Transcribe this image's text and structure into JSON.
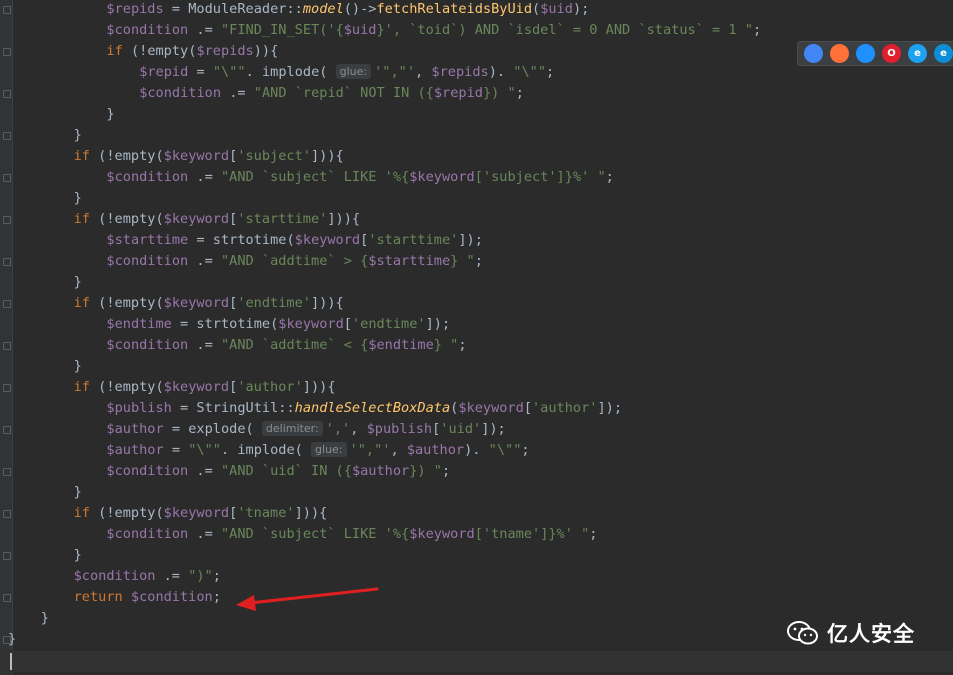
{
  "editor": {
    "lines": [
      {
        "indent": 12,
        "html": "<span class=\"var\">$repids</span> = ModuleReader::<span class=\"func\">model</span>()-&gt;<span class=\"fn2\">fetchRelateidsByUid</span>(<span class=\"var\">$uid</span>);"
      },
      {
        "indent": 12,
        "html": "<span class=\"var\">$condition</span> .= <span class=\"str\">\"FIND_IN_SET('{<span class=\"var\">$uid</span>}', `toid`) AND `isdel` = 0 AND `status` = 1 \"</span>;"
      },
      {
        "indent": 12,
        "html": "<span class=\"kw\">if</span> (!empty(<span class=\"var\">$repids</span>)){"
      },
      {
        "indent": 16,
        "html": "<span class=\"var\">$repid</span> = <span class=\"str\">\"\\\"\"</span>. implode( <span class=\"hint\">glue:</span><span class=\"str\">'\",\"'</span>, <span class=\"var\">$repids</span>). <span class=\"str\">\"\\\"\"</span>;"
      },
      {
        "indent": 16,
        "html": "<span class=\"var\">$condition</span> .= <span class=\"str\">\"AND `repid` NOT IN ({<span class=\"var\">$repid</span>}) \"</span>;"
      },
      {
        "indent": 12,
        "html": "}"
      },
      {
        "indent": 8,
        "html": "}"
      },
      {
        "indent": 8,
        "html": "<span class=\"kw\">if</span> (!empty(<span class=\"var\">$keyword</span>[<span class=\"str\">'subject'</span>])){"
      },
      {
        "indent": 12,
        "html": "<span class=\"var\">$condition</span> .= <span class=\"str\">\"AND `subject` LIKE '%{<span class=\"var\">$keyword</span>['subject']}%' \"</span>;"
      },
      {
        "indent": 8,
        "html": "}"
      },
      {
        "indent": 8,
        "html": "<span class=\"kw\">if</span> (!empty(<span class=\"var\">$keyword</span>[<span class=\"str\">'starttime'</span>])){"
      },
      {
        "indent": 12,
        "html": "<span class=\"var\">$starttime</span> = strtotime(<span class=\"var\">$keyword</span>[<span class=\"str\">'starttime'</span>]);"
      },
      {
        "indent": 12,
        "html": "<span class=\"var\">$condition</span> .= <span class=\"str\">\"AND `addtime` &gt; {<span class=\"var\">$starttime</span>} \"</span>;"
      },
      {
        "indent": 8,
        "html": "}"
      },
      {
        "indent": 8,
        "html": "<span class=\"kw\">if</span> (!empty(<span class=\"var\">$keyword</span>[<span class=\"str\">'endtime'</span>])){"
      },
      {
        "indent": 12,
        "html": "<span class=\"var\">$endtime</span> = strtotime(<span class=\"var\">$keyword</span>[<span class=\"str\">'endtime'</span>]);"
      },
      {
        "indent": 12,
        "html": "<span class=\"var\">$condition</span> .= <span class=\"str\">\"AND `addtime` &lt; {<span class=\"var\">$endtime</span>} \"</span>;"
      },
      {
        "indent": 8,
        "html": "}"
      },
      {
        "indent": 8,
        "html": "<span class=\"kw\">if</span> (!empty(<span class=\"var\">$keyword</span>[<span class=\"str\">'author'</span>])){"
      },
      {
        "indent": 12,
        "html": "<span class=\"var\">$publish</span> = StringUtil::<span class=\"func\">handleSelectBoxData</span>(<span class=\"var\">$keyword</span>[<span class=\"str\">'author'</span>]);"
      },
      {
        "indent": 12,
        "html": "<span class=\"var\">$author</span> = explode( <span class=\"hint\">delimiter:</span><span class=\"str\">','</span>, <span class=\"var\">$publish</span>[<span class=\"str\">'uid'</span>]);"
      },
      {
        "indent": 12,
        "html": "<span class=\"var\">$author</span> = <span class=\"str\">\"\\\"\"</span>. implode( <span class=\"hint\">glue:</span><span class=\"str\">'\",\"'</span>, <span class=\"var\">$author</span>). <span class=\"str\">\"\\\"\"</span>;"
      },
      {
        "indent": 12,
        "html": "<span class=\"var\">$condition</span> .= <span class=\"str\">\"AND `uid` IN ({<span class=\"var\">$author</span>}) \"</span>;"
      },
      {
        "indent": 8,
        "html": "}"
      },
      {
        "indent": 8,
        "html": "<span class=\"kw\">if</span> (!empty(<span class=\"var\">$keyword</span>[<span class=\"str\">'tname'</span>])){"
      },
      {
        "indent": 12,
        "html": "<span class=\"var\">$condition</span> .= <span class=\"str\">\"AND `subject` LIKE '%{<span class=\"var\">$keyword</span>['tname']}%' \"</span>;"
      },
      {
        "indent": 8,
        "html": "}"
      },
      {
        "indent": 8,
        "html": "<span class=\"var\">$condition</span> .= <span class=\"str\">\")\"</span>;"
      },
      {
        "indent": 8,
        "html": "<span class=\"kw\">return</span> <span class=\"var\">$condition</span>;"
      },
      {
        "indent": 4,
        "html": "}"
      },
      {
        "indent": 0,
        "html": "}"
      }
    ]
  },
  "browser_icons": [
    {
      "name": "chrome-icon",
      "glyph": "",
      "color": "#4285f4"
    },
    {
      "name": "firefox-icon",
      "glyph": "",
      "color": "#ff7139"
    },
    {
      "name": "safari-icon",
      "glyph": "",
      "color": "#1e90ff"
    },
    {
      "name": "opera-icon",
      "glyph": "O",
      "color": "#e0202f"
    },
    {
      "name": "ie-icon",
      "glyph": "e",
      "color": "#1ea1f1"
    },
    {
      "name": "edge-icon",
      "glyph": "e",
      "color": "#0c8dd6"
    }
  ],
  "watermark": {
    "icon": "wechat-icon",
    "text": "亿人安全"
  },
  "annotation": {
    "arrow_color": "#e02020"
  }
}
